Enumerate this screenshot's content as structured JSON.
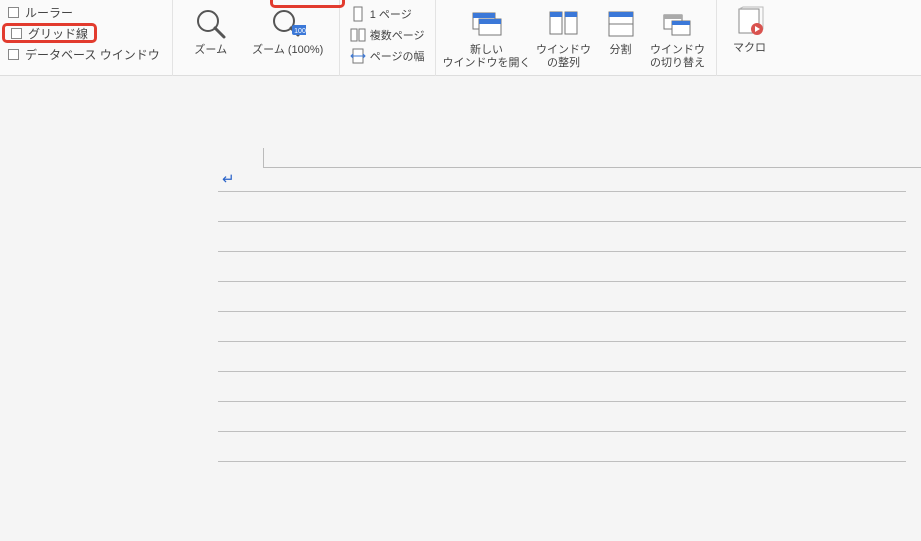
{
  "ribbon": {
    "checklist": {
      "ruler": "ルーラー",
      "gridlines": "グリッド線",
      "database_window": "データベース ウインドウ"
    },
    "zoom": {
      "zoom_label": "ズーム",
      "zoom100_label": "ズーム (100%)"
    },
    "pageview": {
      "one_page": "1 ページ",
      "multi_page": "複数ページ",
      "page_width": "ページの幅"
    },
    "window": {
      "new_window": "新しい\nウインドウを開く",
      "arrange": "ウインドウ\nの整列",
      "split": "分割",
      "switch": "ウインドウ\nの切り替え"
    },
    "macro": {
      "label": "マクロ"
    }
  }
}
